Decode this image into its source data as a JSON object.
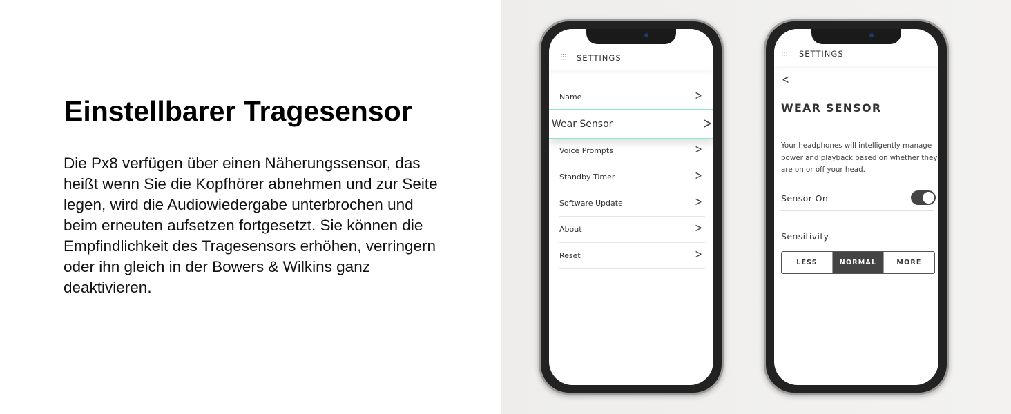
{
  "heading": "Einstellbarer Tragesensor",
  "body": "Die Px8 verfügen über einen Näherungssensor, das heißt wenn Sie die Kopfhörer abnehmen und zur Seite legen, wird die Audiowiedergabe unterbrochen und beim erneuten aufsetzen fortgesetzt. Sie können die Empfindlichkeit des Tragesensors erhöhen, verringern oder ihn gleich in der Bowers & Wilkins ganz deaktivieren.",
  "phone1": {
    "header": "SETTINGS",
    "items": [
      "Name",
      "Wear Sensor",
      "Voice Prompts",
      "Standby Timer",
      "Software Update",
      "About",
      "Reset"
    ],
    "highlight_color": "#8ee8d2"
  },
  "phone2": {
    "header": "SETTINGS",
    "title": "WEAR SENSOR",
    "description": "Your headphones will intelligently manage power and playback based on whether they are on or off your head.",
    "sensor_label": "Sensor On",
    "sensor_on": true,
    "sensitivity_label": "Sensitivity",
    "options": [
      "LESS",
      "NORMAL",
      "MORE"
    ],
    "selected": "NORMAL"
  }
}
